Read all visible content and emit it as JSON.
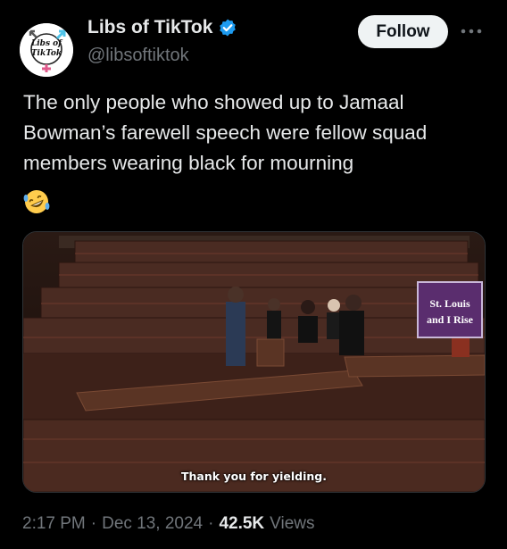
{
  "author": {
    "display_name": "Libs of TikTok",
    "handle": "@libsoftiktok",
    "logo_text_top": "Libs of",
    "logo_text_bottom": "TikTok",
    "verified_color": "#1d9bf0"
  },
  "follow_label": "Follow",
  "more_icon": "more-horizontal-icon",
  "tweet": {
    "text": "The only people who showed up to Jamaal Bowman’s farewell speech were fellow squad members wearing black for mourning",
    "emoji": "rolling-on-floor-laughing-icon"
  },
  "media": {
    "caption": "Thank you for yielding.",
    "sign_line1": "St. Louis",
    "sign_line2": "and I Rise"
  },
  "meta": {
    "time": "2:17 PM",
    "separator": "·",
    "date": "Dec 13, 2024",
    "views_count": "42.5K",
    "views_label": "Views"
  }
}
